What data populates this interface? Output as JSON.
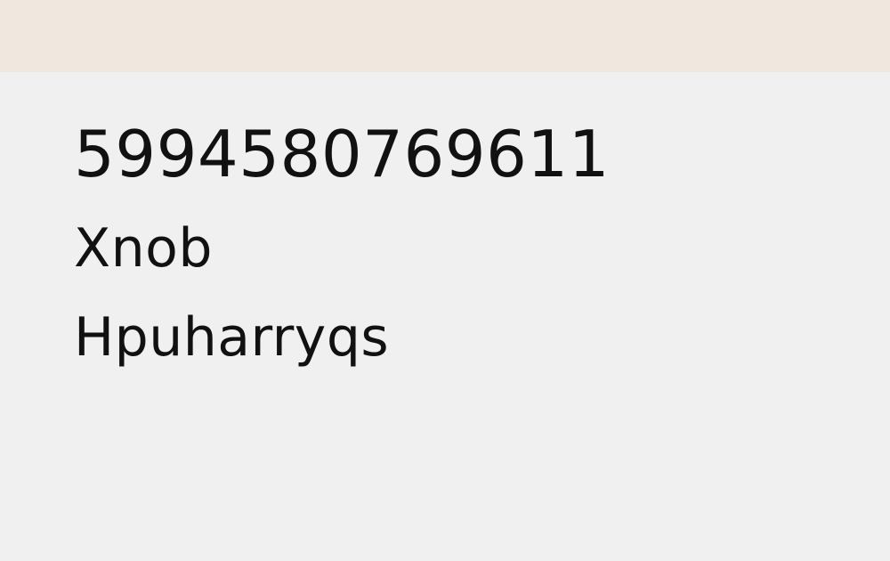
{
  "header": {
    "background": "#f0e7de"
  },
  "main": {
    "background": "#f0f0f0",
    "text_color": "#111111",
    "number": "5994580769611",
    "primary_text": "Xnob",
    "secondary_text": "Hpuharryqs"
  }
}
